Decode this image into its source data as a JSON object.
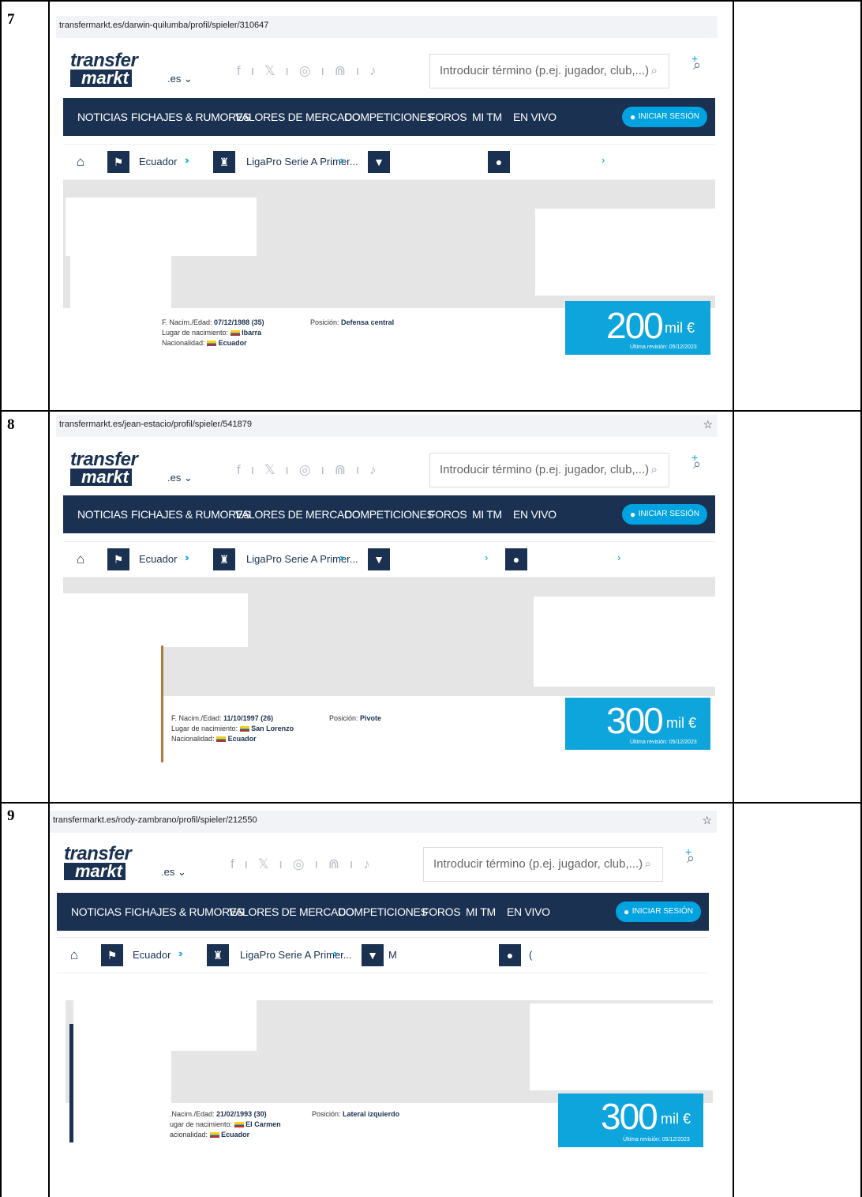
{
  "rows": [
    {
      "number": "7",
      "url": "transfermarkt.es/darwin-quilumba/profil/spieler/310647",
      "birth_label": "F. Nacim./Edad:",
      "birth_value": "07/12/1988 (35)",
      "place_label": "Lugar de nacimiento:",
      "place_value": "Ibarra",
      "nat_label": "Nacionalidad:",
      "nat_value": "Ecuador",
      "pos_label": "Posición:",
      "pos_value": "Defensa central",
      "market_value": "200",
      "market_unit": "mil €",
      "revision": "Última revisión: 05/12/2023"
    },
    {
      "number": "8",
      "url": "transfermarkt.es/jean-estacio/profil/spieler/541879",
      "birth_label": "F. Nacim./Edad:",
      "birth_value": "11/10/1997 (26)",
      "place_label": "Lugar de nacimiento:",
      "place_value": "San Lorenzo",
      "nat_label": "Nacionalidad:",
      "nat_value": "Ecuador",
      "pos_label": "Posición:",
      "pos_value": "Pivote",
      "market_value": "300",
      "market_unit": "mil €",
      "revision": "Última revisión: 05/12/2023"
    },
    {
      "number": "9",
      "url": "transfermarkt.es/rody-zambrano/profil/spieler/212550",
      "birth_label": ".Nacim./Edad:",
      "birth_value": "21/02/1993 (30)",
      "place_label": "ugar de nacimiento:",
      "place_value": "El Carmen",
      "nat_label": "acionalidad:",
      "nat_value": "Ecuador",
      "pos_label": "Posición:",
      "pos_value": "Lateral izquierdo",
      "market_value": "300",
      "market_unit": "mil €",
      "revision": "Última revisión: 05/12/2023"
    }
  ],
  "site": {
    "logo_line1": "transfer",
    "logo_line2": "markt",
    "domain": ".es ⌄",
    "social": "f ı 𝕏 ı ◎ ı ⋒ ı ♪",
    "search_placeholder": "Introducir término (p.ej. jugador, club,...)",
    "nav": [
      "NOTICIAS",
      "FICHAJES & RUMORES",
      "VALORES DE MERCADO",
      "COMPETICIONES",
      "FOROS",
      "MI TM",
      "EN VIVO"
    ],
    "login": "INICIAR SESIÓN",
    "bc_country": "Ecuador",
    "bc_league": "LigaPro Serie A Primer...",
    "bc_club_row9": "M",
    "bc_player_row9": "("
  }
}
